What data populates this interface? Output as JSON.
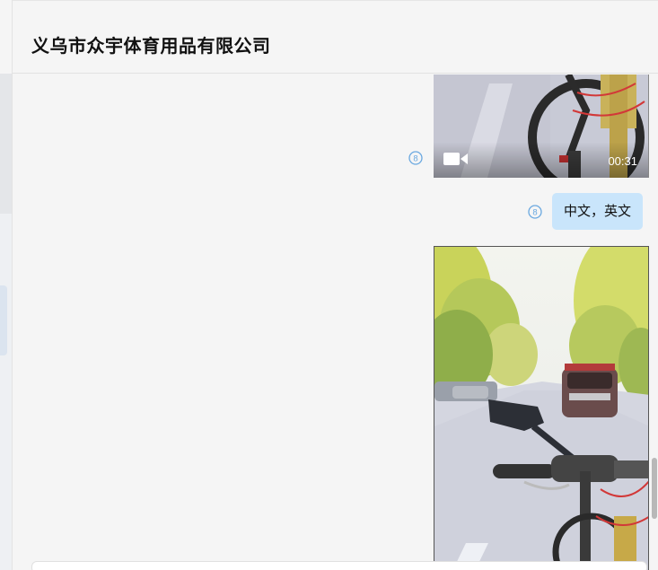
{
  "header": {
    "title": "义乌市众宇体育用品有限公司"
  },
  "messages": [
    {
      "kind": "video",
      "duration": "00:31",
      "read_indicator": "8",
      "icon": "video-camera-icon"
    },
    {
      "kind": "text",
      "text": "中文，英文",
      "read_indicator": "8"
    },
    {
      "kind": "image",
      "description_icon": "photo-thumbnail"
    }
  ],
  "colors": {
    "background": "#f5f5f5",
    "bubble": "#c9e5fb",
    "read_indicator": "#6aa8e0"
  }
}
